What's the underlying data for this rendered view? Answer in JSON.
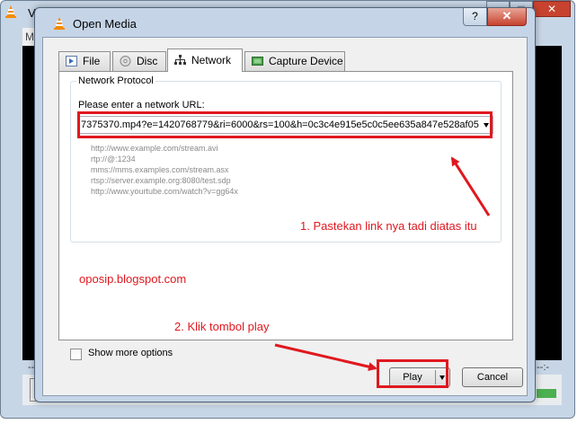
{
  "background_window": {
    "title": "V",
    "menu_label": "Me",
    "time_left": "--:-",
    "time_right": "--:-"
  },
  "dialog": {
    "title": "Open Media",
    "help_label": "?",
    "close_label": "✕",
    "tabs": [
      {
        "label": "File",
        "icon": "file-icon",
        "active": false
      },
      {
        "label": "Disc",
        "icon": "disc-icon",
        "active": false
      },
      {
        "label": "Network",
        "icon": "network-icon",
        "active": true
      },
      {
        "label": "Capture Device",
        "icon": "capture-device-icon",
        "active": false
      }
    ],
    "network_protocol": {
      "legend": "Network Protocol",
      "url_label": "Please enter a network URL:",
      "url_value": "7375370.mp4?e=1420768779&ri=6000&rs=100&h=0c3c4e915e5c0c5ee635a847e528af05",
      "examples": [
        "http://www.example.com/stream.avi",
        "rtp://@:1234",
        "mms://mms.examples.com/stream.asx",
        "rtsp://server.example.org:8080/test.sdp",
        "http://www.yourtube.com/watch?v=gg64x"
      ]
    },
    "show_more_label": "Show more options",
    "show_more_checked": false,
    "play_label": "Play",
    "cancel_label": "Cancel"
  },
  "annotations": {
    "step1": "1. Pastekan link nya tadi diatas itu",
    "step2": "2. Klik tombol play",
    "blog": "oposip.blogspot.com",
    "color": "#e0181f"
  }
}
